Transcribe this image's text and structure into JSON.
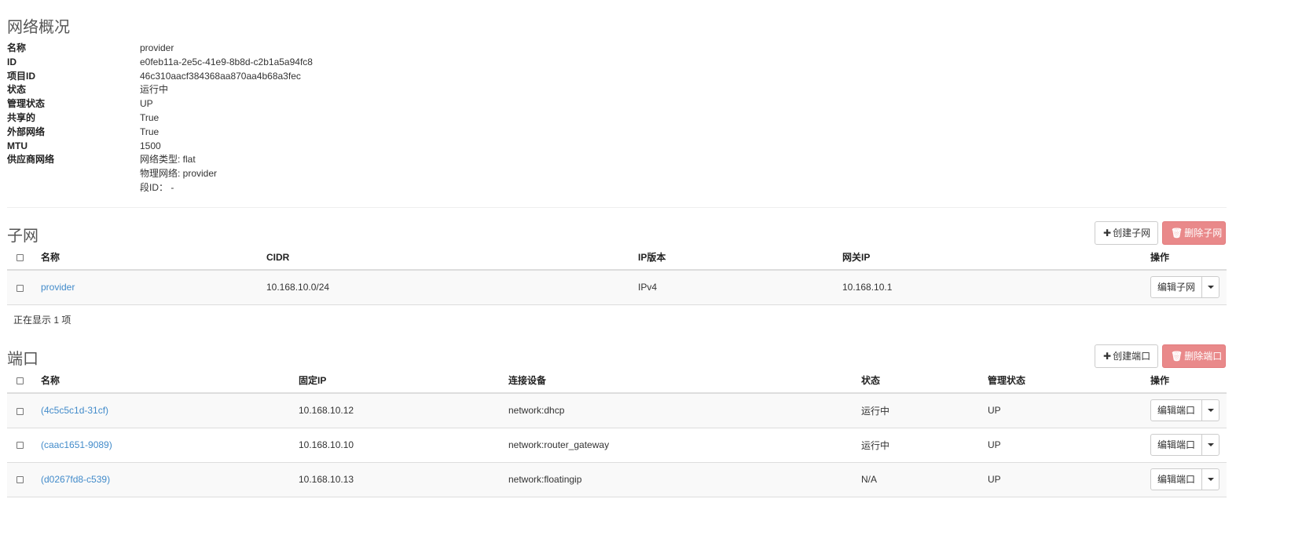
{
  "overview": {
    "title": "网络概况",
    "rows": [
      {
        "label": "名称",
        "value": "provider"
      },
      {
        "label": "ID",
        "value": "e0feb11a-2e5c-41e9-8b8d-c2b1a5a94fc8"
      },
      {
        "label": "项目ID",
        "value": "46c310aacf384368aa870aa4b68a3fec"
      },
      {
        "label": "状态",
        "value": "运行中"
      },
      {
        "label": "管理状态",
        "value": "UP"
      },
      {
        "label": "共享的",
        "value": "True"
      },
      {
        "label": "外部网络",
        "value": "True"
      },
      {
        "label": "MTU",
        "value": "1500"
      }
    ],
    "provider_label": "供应商网络",
    "provider_lines": [
      "网络类型: flat",
      "物理网络: provider",
      "段ID： -"
    ]
  },
  "subnets": {
    "title": "子网",
    "create_label": "创建子网",
    "delete_label": "删除子网",
    "headers": [
      "名称",
      "CIDR",
      "IP版本",
      "网关IP",
      "操作"
    ],
    "rows": [
      {
        "name": "provider",
        "cidr": "10.168.10.0/24",
        "ip_version": "IPv4",
        "gateway": "10.168.10.1",
        "action": "编辑子网"
      }
    ],
    "footer": "正在显示 1 项"
  },
  "ports": {
    "title": "端口",
    "create_label": "创建端口",
    "delete_label": "删除端口",
    "headers": [
      "名称",
      "固定IP",
      "连接设备",
      "状态",
      "管理状态",
      "操作"
    ],
    "rows": [
      {
        "name": "(4c5c5c1d-31cf)",
        "ip": "10.168.10.12",
        "device": "network:dhcp",
        "status": "运行中",
        "admin": "UP",
        "action": "编辑端口"
      },
      {
        "name": "(caac1651-9089)",
        "ip": "10.168.10.10",
        "device": "network:router_gateway",
        "status": "运行中",
        "admin": "UP",
        "action": "编辑端口"
      },
      {
        "name": "(d0267fd8-c539)",
        "ip": "10.168.10.13",
        "device": "network:floatingip",
        "status": "N/A",
        "admin": "UP",
        "action": "编辑端口"
      }
    ]
  },
  "icons": {
    "create": "plus-icon",
    "delete": "trash-icon",
    "dropdown": "caret-down-icon"
  },
  "colors": {
    "link": "#428bca",
    "danger_disabled": "#e9898a"
  }
}
